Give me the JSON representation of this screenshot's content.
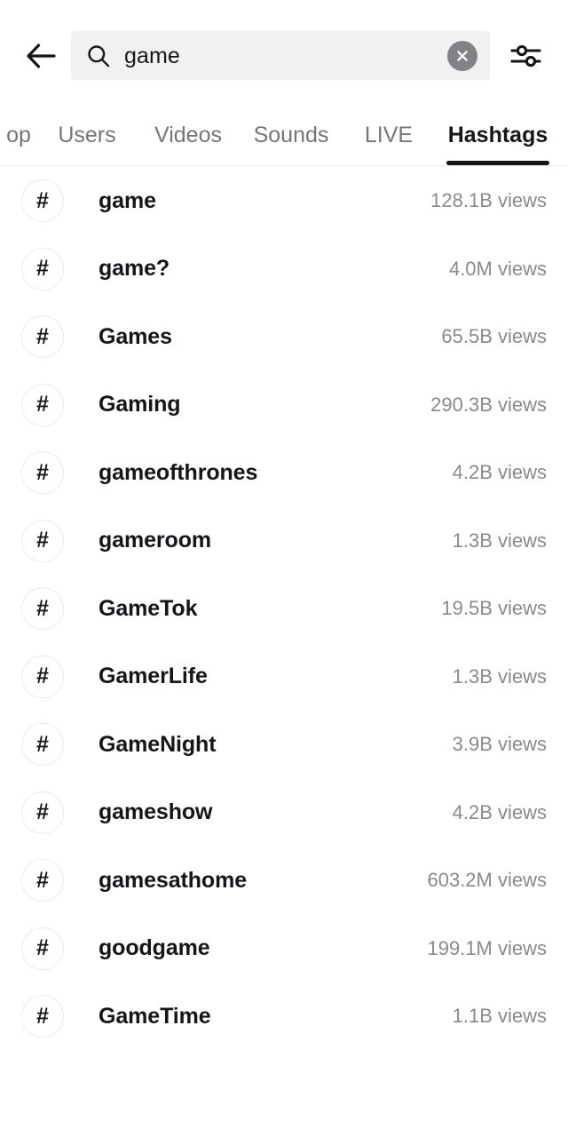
{
  "header": {
    "back_icon": "arrow-left-icon",
    "search": {
      "icon": "search-icon",
      "value": "game",
      "placeholder": "Search",
      "clear_icon": "close-circle-icon",
      "clear_label": "Clear search"
    },
    "filter": {
      "icon": "filter-sliders-icon",
      "label": "Filters"
    },
    "colors": {
      "field_background": "#f1f1f1",
      "clear_button": "#828287",
      "text": "#16151a"
    }
  },
  "tabs": {
    "items": [
      {
        "label": "op",
        "full_label": "Top",
        "active": false,
        "truncated": true
      },
      {
        "label": "Users",
        "active": false,
        "truncated": false
      },
      {
        "label": "Videos",
        "active": false,
        "truncated": false
      },
      {
        "label": "Sounds",
        "active": false,
        "truncated": false
      },
      {
        "label": "LIVE",
        "active": false,
        "truncated": false
      },
      {
        "label": "Hashtags",
        "active": true,
        "truncated": false
      }
    ],
    "active_index": 5,
    "colors": {
      "active": "#16151a",
      "inactive": "#76767a",
      "indicator": "#16151a",
      "border": "#f0f0f1"
    }
  },
  "results": {
    "views_suffix": "views",
    "hash_glyph": "#",
    "items": [
      {
        "name": "game",
        "views": "128.1B views"
      },
      {
        "name": "game?",
        "views": "4.0M views"
      },
      {
        "name": "Games",
        "views": "65.5B views"
      },
      {
        "name": "Gaming",
        "views": "290.3B views"
      },
      {
        "name": "gameofthrones",
        "views": "4.2B views"
      },
      {
        "name": "gameroom",
        "views": "1.3B views"
      },
      {
        "name": "GameTok",
        "views": "19.5B views"
      },
      {
        "name": "GamerLife",
        "views": "1.3B views"
      },
      {
        "name": "GameNight",
        "views": "3.9B views"
      },
      {
        "name": "gameshow",
        "views": "4.2B views"
      },
      {
        "name": "gamesathome",
        "views": "603.2M views"
      },
      {
        "name": "goodgame",
        "views": "199.1M views"
      },
      {
        "name": "GameTime",
        "views": "1.1B views"
      }
    ]
  }
}
